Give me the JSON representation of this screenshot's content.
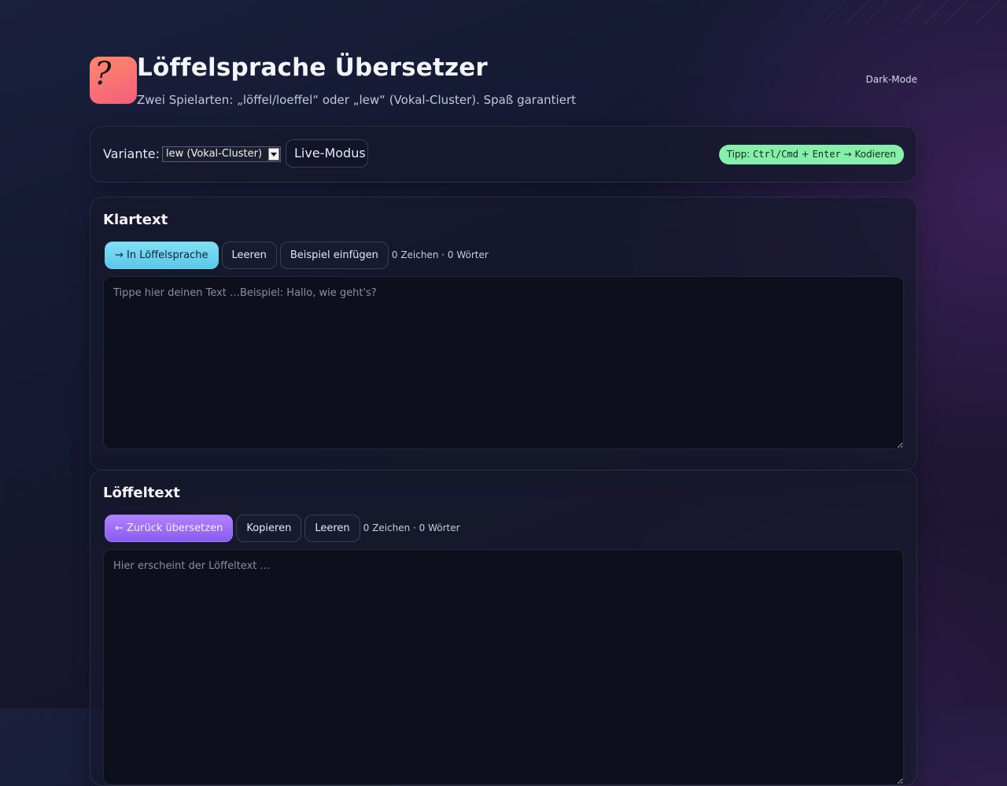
{
  "header": {
    "logo_glyph": "?",
    "title": "Löffelsprache Übersetzer",
    "subtitle": "Zwei Spielarten: „löffel/loeffel“ oder „lew“ (Vokal-Cluster). Spaß garantiert",
    "darkmode_label": "Dark-Mode"
  },
  "controls": {
    "variant_label": "Variante:",
    "variant_selected": "lew (Vokal-Cluster)",
    "live_label": "Live-Modus",
    "tip_prefix": "Tipp:",
    "tip_keys": "Ctrl/Cmd",
    "tip_plus": "+",
    "tip_key2": "Enter",
    "tip_suffix": "→ Kodieren"
  },
  "klartext": {
    "title": "Klartext",
    "encode_button": "→ In Löffelsprache",
    "clear_button": "Leeren",
    "example_button": "Beispiel einfügen",
    "counter": "0 Zeichen · 0 Wörter",
    "placeholder": "Tippe hier deinen Text …Beispiel: Hallo, wie geht's?",
    "value": ""
  },
  "loeffeltext": {
    "title": "Löffeltext",
    "decode_button": "← Zurück übersetzen",
    "copy_button": "Kopieren",
    "clear_button": "Leeren",
    "counter": "0 Zeichen · 0 Wörter",
    "placeholder": "Hier erscheint der Löffeltext …",
    "value": ""
  },
  "colors": {
    "accent_cyan": "#5cc7ea",
    "accent_purple": "#8a5cf0",
    "tip_green": "#86efac",
    "logo_gradient_start": "#ff8a6a",
    "logo_gradient_end": "#f45d7c"
  }
}
